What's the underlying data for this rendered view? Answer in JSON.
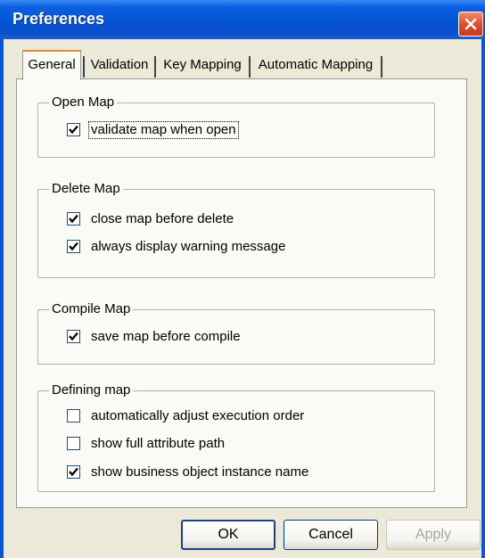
{
  "window": {
    "title": "Preferences"
  },
  "tabs": [
    {
      "label": "General",
      "active": true
    },
    {
      "label": "Validation",
      "active": false
    },
    {
      "label": "Key Mapping",
      "active": false
    },
    {
      "label": "Automatic Mapping",
      "active": false
    }
  ],
  "groups": {
    "open_map": {
      "title": "Open Map",
      "options": [
        {
          "label": "validate map when open",
          "checked": true
        }
      ]
    },
    "delete_map": {
      "title": "Delete Map",
      "options": [
        {
          "label": "close map before delete",
          "checked": true
        },
        {
          "label": "always display warning message",
          "checked": true
        }
      ]
    },
    "compile_map": {
      "title": "Compile Map",
      "options": [
        {
          "label": "save map before compile",
          "checked": true
        }
      ]
    },
    "defining_map": {
      "title": "Defining map",
      "options": [
        {
          "label": "automatically adjust execution order",
          "checked": false
        },
        {
          "label": "show full attribute path",
          "checked": false
        },
        {
          "label": "show business object instance name",
          "checked": true
        }
      ]
    }
  },
  "buttons": {
    "ok": "OK",
    "cancel": "Cancel",
    "apply": "Apply"
  },
  "colors": {
    "titlebar": "#0553d4",
    "dialog_bg": "#ece9d8",
    "close": "#e0502a"
  },
  "icons": {
    "close": "close-icon",
    "check": "checkmark-icon"
  }
}
